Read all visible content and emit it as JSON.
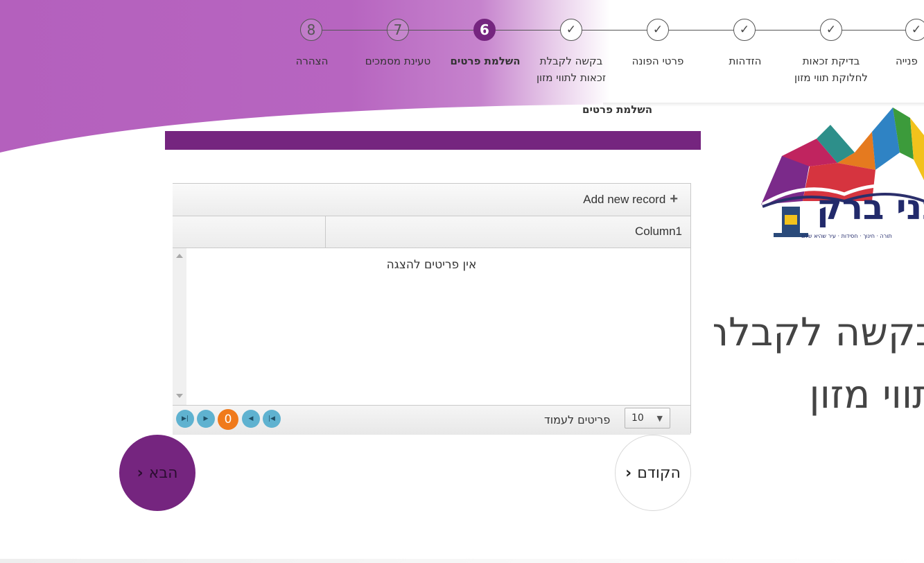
{
  "stepper": {
    "steps": [
      {
        "number": "8",
        "label": "הצהרה",
        "state": "pending"
      },
      {
        "number": "7",
        "label": "טעינת מסמכים",
        "state": "pending"
      },
      {
        "number": "6",
        "label": "השלמת פרטים",
        "state": "active"
      },
      {
        "number": "✓",
        "label": "בקשה לקבלת",
        "label2": "זכאות לתווי מזון",
        "state": "done"
      },
      {
        "number": "✓",
        "label": "פרטי הפונה",
        "state": "done"
      },
      {
        "number": "✓",
        "label": "הזדהות",
        "state": "done"
      },
      {
        "number": "✓",
        "label": "בדיקת זכאות",
        "label2": "לחלוקת תווי מזון",
        "state": "done"
      },
      {
        "number": "✓",
        "label": "פנייה",
        "state": "done"
      }
    ]
  },
  "section_title": "השלמת פרטים",
  "grid": {
    "add_record": "Add new record",
    "columns": [
      "Column1"
    ],
    "empty_message": "אין פריטים להצגה",
    "pager": {
      "current_page": "0",
      "page_size": "10",
      "page_size_label": "פריטים לעמוד"
    }
  },
  "nav": {
    "next_label": "הבא",
    "prev_label": "הקודם"
  },
  "page_heading": {
    "line1": "בקשה לקבלת",
    "line2": "תווי מזון"
  },
  "logo": {
    "text": "בני ברק",
    "subtitle": "תורה · חינוך · חסידות · עיר שהיא שלם"
  },
  "colors": {
    "brand_purple": "#75257f",
    "header_purple": "#b765c0",
    "pager_blue": "#5fb2d0",
    "pager_orange": "#f07a1b"
  }
}
